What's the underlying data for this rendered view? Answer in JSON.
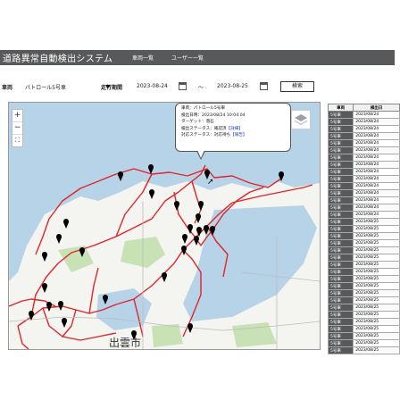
{
  "header": {
    "title": "道路異常自動検出システム",
    "nav": [
      "車両一覧",
      "ユーザー一覧"
    ]
  },
  "filter": {
    "vehicle_label": "車両",
    "vehicle_value": "パトロール5号車",
    "period_label": "走行期間",
    "date_from": "2023-08-24",
    "tilde": "～",
    "date_to": "2023-08-25",
    "search_label": "検索"
  },
  "map": {
    "zoom_in": "+",
    "zoom_out": "−",
    "fullscreen": "⛶",
    "city_label": "出雲市",
    "popup": {
      "vehicle": "車両：パトロール5号車",
      "detected_at": "検出日時：2023/08/24 10:04:04",
      "target": "ターゲット：落石",
      "detect_status": "検出ステータス：確認済",
      "detect_link": "【詳細】",
      "action_status": "対応ステータス：対応待ち",
      "action_link": "【報告】"
    }
  },
  "table": {
    "headers": [
      "車両",
      "検出日"
    ],
    "rows": [
      [
        "5号車",
        "2023/08/24"
      ],
      [
        "5号車",
        "2023/08/24"
      ],
      [
        "5号車",
        "2023/08/24"
      ],
      [
        "5号車",
        "2023/08/24"
      ],
      [
        "5号車",
        "2023/08/24"
      ],
      [
        "5号車",
        "2023/08/24"
      ],
      [
        "5号車",
        "2023/08/24"
      ],
      [
        "5号車",
        "2023/08/24"
      ],
      [
        "5号車",
        "2023/08/24"
      ],
      [
        "5号車",
        "2023/08/24"
      ],
      [
        "5号車",
        "2023/08/24"
      ],
      [
        "5号車",
        "2023/08/24"
      ],
      [
        "5号車",
        "2023/08/24"
      ],
      [
        "5号車",
        "2023/08/24"
      ],
      [
        "5号車",
        "2023/08/24"
      ],
      [
        "5号車",
        "2023/08/25"
      ],
      [
        "5号車",
        "2023/08/25"
      ],
      [
        "5号車",
        "2023/08/25"
      ],
      [
        "5号車",
        "2023/08/25"
      ],
      [
        "5号車",
        "2023/08/25"
      ],
      [
        "5号車",
        "2023/08/25"
      ],
      [
        "5号車",
        "2023/08/25"
      ],
      [
        "5号車",
        "2023/08/25"
      ],
      [
        "5号車",
        "2023/08/25"
      ],
      [
        "5号車",
        "2023/08/25"
      ],
      [
        "5号車",
        "2023/08/25"
      ],
      [
        "5号車",
        "2023/08/25"
      ],
      [
        "5号車",
        "2023/08/25"
      ],
      [
        "5号車",
        "2023/08/25"
      ],
      [
        "5号車",
        "2023/08/25"
      ],
      [
        "5号車",
        "2023/08/25"
      ],
      [
        "5号車",
        "2023/08/25"
      ],
      [
        "5号車",
        "2023/08/25"
      ],
      [
        "5号車",
        "2023/08/25"
      ]
    ]
  },
  "colors": {
    "header_bg": "#58595b",
    "route_red": "#e0242a",
    "sea": "#b7d3e8",
    "land": "#f4f4f1",
    "green": "#c9e2b5"
  }
}
